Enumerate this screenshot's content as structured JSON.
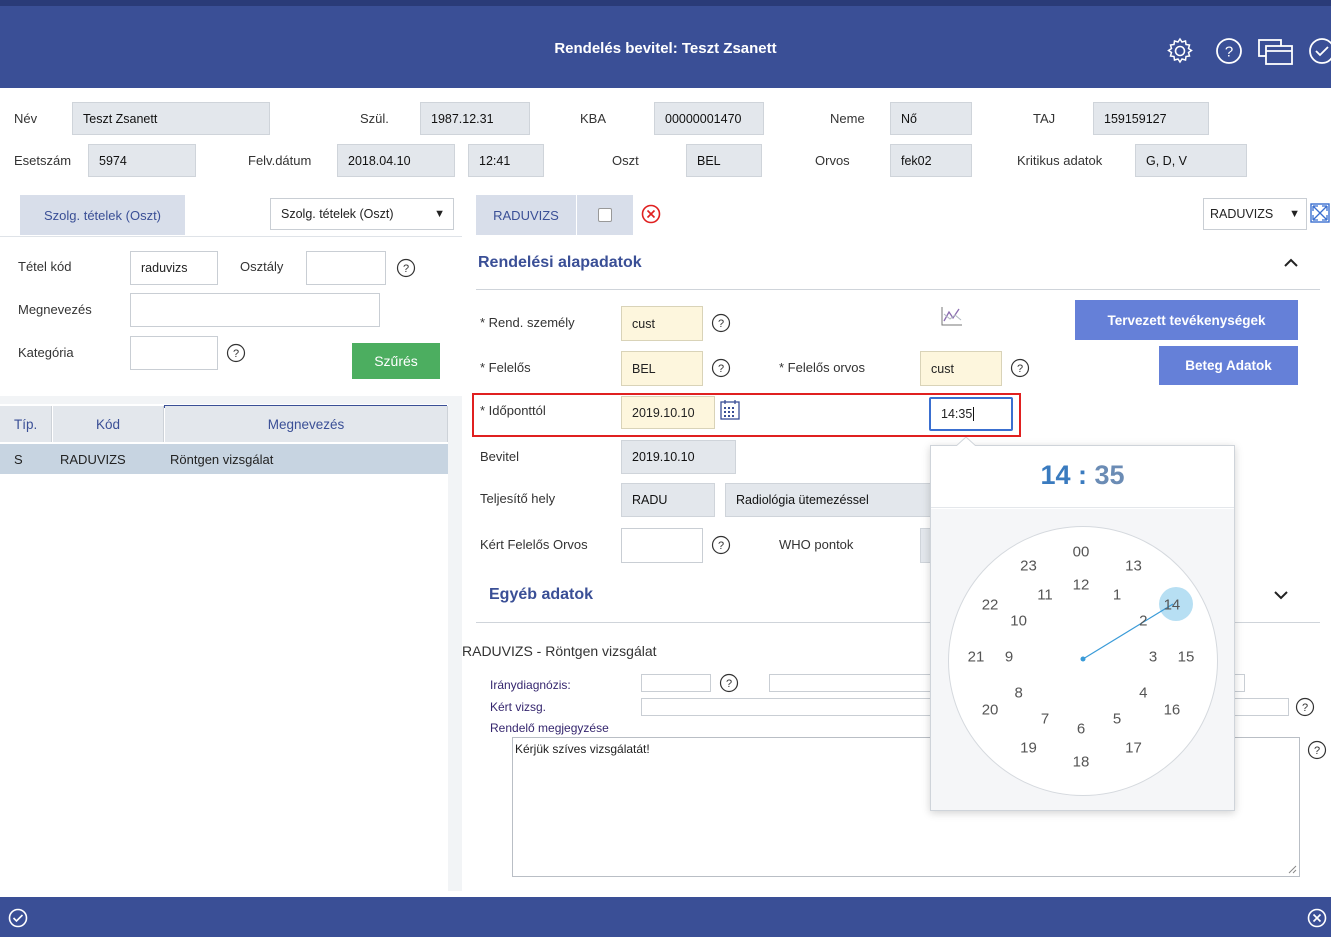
{
  "header": {
    "title": "Rendelés bevitel: Teszt Zsanett"
  },
  "patient": {
    "nev_label": "Név",
    "nev": "Teszt Zsanett",
    "szul_label": "Szül.",
    "szul": "1987.12.31",
    "kba_label": "KBA",
    "kba": "00000001470",
    "neme_label": "Neme",
    "neme": "Nő",
    "taj_label": "TAJ",
    "taj": "159159127",
    "esetszam_label": "Esetszám",
    "esetszam": "5974",
    "felv_label": "Felv.dátum",
    "felv_datum": "2018.04.10",
    "felv_ido": "12:41",
    "oszt_label": "Oszt",
    "oszt": "BEL",
    "orvos_label": "Orvos",
    "orvos": "fek02",
    "kritikus_label": "Kritikus adatok",
    "kritikus": "G, D, V"
  },
  "left": {
    "tab_label": "Szolg. tételek (Oszt)",
    "select_value": "Szolg. tételek (Oszt)",
    "tetel_kod_label": "Tétel kód",
    "tetel_kod": "raduvizs",
    "osztaly_label": "Osztály",
    "osztaly": "",
    "megnevezes_label": "Megnevezés",
    "megnevezes": "",
    "kategoria_label": "Kategória",
    "kategoria": "",
    "filter_button": "Szűrés",
    "columns": [
      "Típ.",
      "Kód",
      "Megnevezés"
    ],
    "rows": [
      {
        "tip": "S",
        "kod": "RADUVIZS",
        "megnevezes": "Röntgen vizsgálat"
      }
    ]
  },
  "right": {
    "tab_label": "RADUVIZS",
    "select_value": "RADUVIZS",
    "section1": "Rendelési alapadatok",
    "rend_szemely_label": "* Rend. személy",
    "rend_szemely": "cust",
    "felelos_label": "* Felelős",
    "felelos": "BEL",
    "felelos_orvos_label": "* Felelős orvos",
    "felelos_orvos": "cust",
    "idopont_label": "* Időponttól",
    "idopont_datum": "2019.10.10",
    "idopont_ido": "14:35",
    "bevitel_label": "Bevitel",
    "bevitel": "2019.10.10",
    "teljesito_label": "Teljesítő hely",
    "teljesito_kod": "RADU",
    "teljesito_nev": "Radiológia ütemezéssel",
    "kert_orvos_label": "Kért Felelős Orvos",
    "kert_orvos": "",
    "who_label": "WHO pontok",
    "btn_tervezett": "Tervezett tevékenységek",
    "btn_beteg": "Beteg Adatok",
    "section2": "Egyéb adatok",
    "exam_title": "RADUVIZS - Röntgen vizsgálat",
    "iranydiag_label": "Iránydiagnózis:",
    "kert_vizsg_label": "Kért vizsg.",
    "megjegyzes_label": "Rendelő megjegyzése",
    "megjegyzes": "Kérjük szíves vizsgálatát!"
  },
  "clock": {
    "hour": "14",
    "separator": ":",
    "minute": "35",
    "outer": [
      "00",
      "13",
      "14",
      "15",
      "16",
      "17",
      "18",
      "19",
      "20",
      "21",
      "22",
      "23"
    ],
    "inner": [
      "12",
      "1",
      "2",
      "3",
      "4",
      "5",
      "6",
      "7",
      "8",
      "9",
      "10",
      "11"
    ]
  },
  "colors": {
    "primary": "#3a4f96",
    "accent_button": "#6580d8",
    "filter_green": "#4cae60",
    "highlight_red": "#e02020",
    "clock_selected": "#b7dff3"
  }
}
